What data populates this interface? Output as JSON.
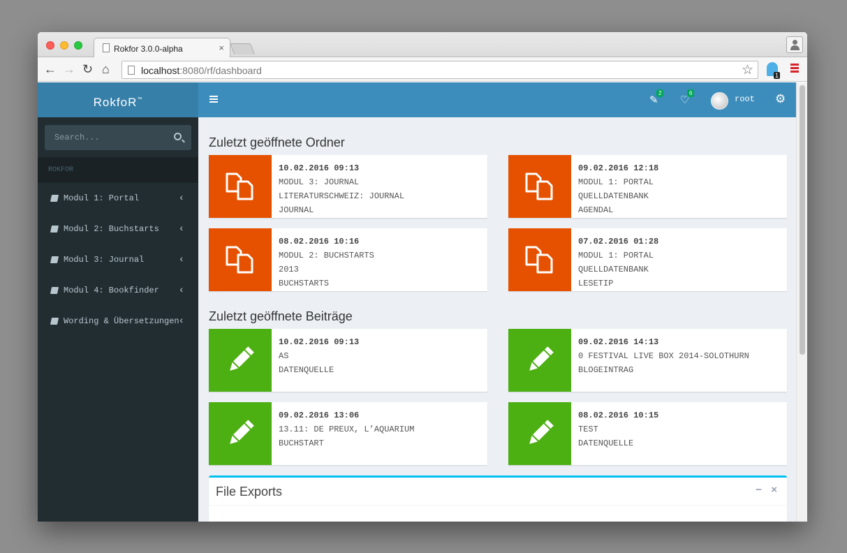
{
  "browser": {
    "tab_title": "Rokfor 3.0.0-alpha",
    "tab_close": "×",
    "url_host": "localhost",
    "url_rest": ":8080/rf/dashboard",
    "extension_badge": "1"
  },
  "sidebar": {
    "logo": "RokfoR",
    "logo_tm": "™",
    "search_placeholder": "Search...",
    "header": "ROKFOR",
    "items": [
      {
        "label": "Modul 1: Portal"
      },
      {
        "label": "Modul 2: Buchstarts"
      },
      {
        "label": "Modul 3: Journal"
      },
      {
        "label": "Modul 4: Bookfinder"
      },
      {
        "label": "Wording & Übersetzungen"
      }
    ]
  },
  "topbar": {
    "edit_badge": "2",
    "heart_badge": "6",
    "user": "root"
  },
  "folders": {
    "title": "Zuletzt geöffnete Ordner",
    "cards": [
      {
        "date": "10.02.2016 09:13",
        "line1": "MODUL 3: JOURNAL",
        "line2": "LITERATURSCHWEIZ: JOURNAL",
        "line3": "JOURNAL"
      },
      {
        "date": "09.02.2016 12:18",
        "line1": "MODUL 1: PORTAL",
        "line2": "QUELLDATENBANK",
        "line3": "AGENDAL"
      },
      {
        "date": "08.02.2016 10:16",
        "line1": "MODUL 2: BUCHSTARTS",
        "line2": "2013",
        "line3": "BUCHSTARTS"
      },
      {
        "date": "07.02.2016 01:28",
        "line1": "MODUL 1: PORTAL",
        "line2": "QUELLDATENBANK",
        "line3": "LESETIP"
      }
    ]
  },
  "posts": {
    "title": "Zuletzt geöffnete Beiträge",
    "cards": [
      {
        "date": "10.02.2016 09:13",
        "line1": "AS",
        "line2": "DATENQUELLE"
      },
      {
        "date": "09.02.2016 14:13",
        "line1": "0 FESTIVAL LIVE BOX 2014-SOLOTHURN",
        "line2": "BLOGEINTRAG"
      },
      {
        "date": "09.02.2016 13:06",
        "line1": "13.11: DE PREUX, L’AQUARIUM",
        "line2": "BUCHSTART"
      },
      {
        "date": "08.02.2016 10:15",
        "line1": "TEST",
        "line2": "DATENQUELLE"
      }
    ]
  },
  "exports": {
    "title": "File Exports",
    "minimize": "−",
    "close": "×"
  },
  "colors": {
    "folder_accent": "#e65100",
    "post_accent": "#4caf12",
    "header": "#3c8dbc",
    "sidebar": "#222d32"
  }
}
